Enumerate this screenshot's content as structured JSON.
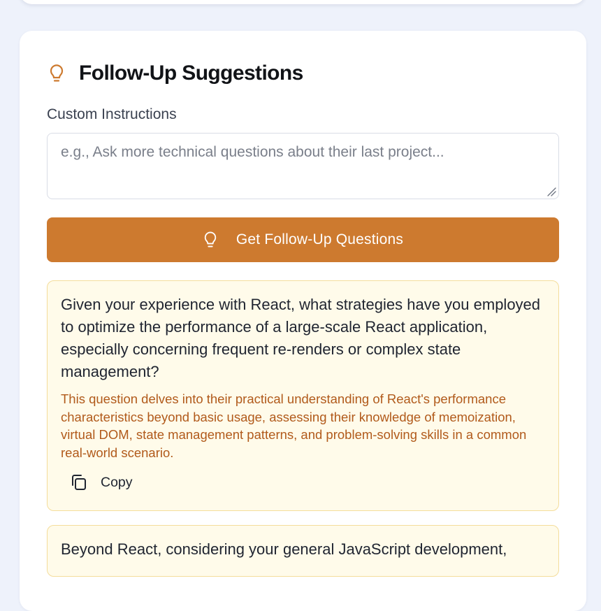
{
  "section": {
    "title": "Follow-Up Suggestions",
    "icon": "lightbulb-icon",
    "accent_color": "#cd7a2f"
  },
  "custom_instructions": {
    "label": "Custom Instructions",
    "value": "",
    "placeholder": "e.g., Ask more technical questions about their last project..."
  },
  "get_button": {
    "label": "Get Follow-Up Questions",
    "icon": "lightbulb-icon"
  },
  "suggestions": [
    {
      "question": "Given your experience with React, what strategies have you employed to optimize the performance of a large-scale React application, especially concerning frequent re-renders or complex state management?",
      "rationale": "This question delves into their practical understanding of React's performance characteristics beyond basic usage, assessing their knowledge of memoization, virtual DOM, state management patterns, and problem-solving skills in a common real-world scenario.",
      "copy_label": "Copy",
      "copy_icon": "copy-icon"
    },
    {
      "question": "Beyond React, considering your general JavaScript development,"
    }
  ],
  "colors": {
    "card_background": "#ffffff",
    "page_background": "#eef2fb",
    "suggestion_background": "#fffbea",
    "suggestion_border": "#f4dd9b",
    "rationale_text": "#b15a1b"
  }
}
